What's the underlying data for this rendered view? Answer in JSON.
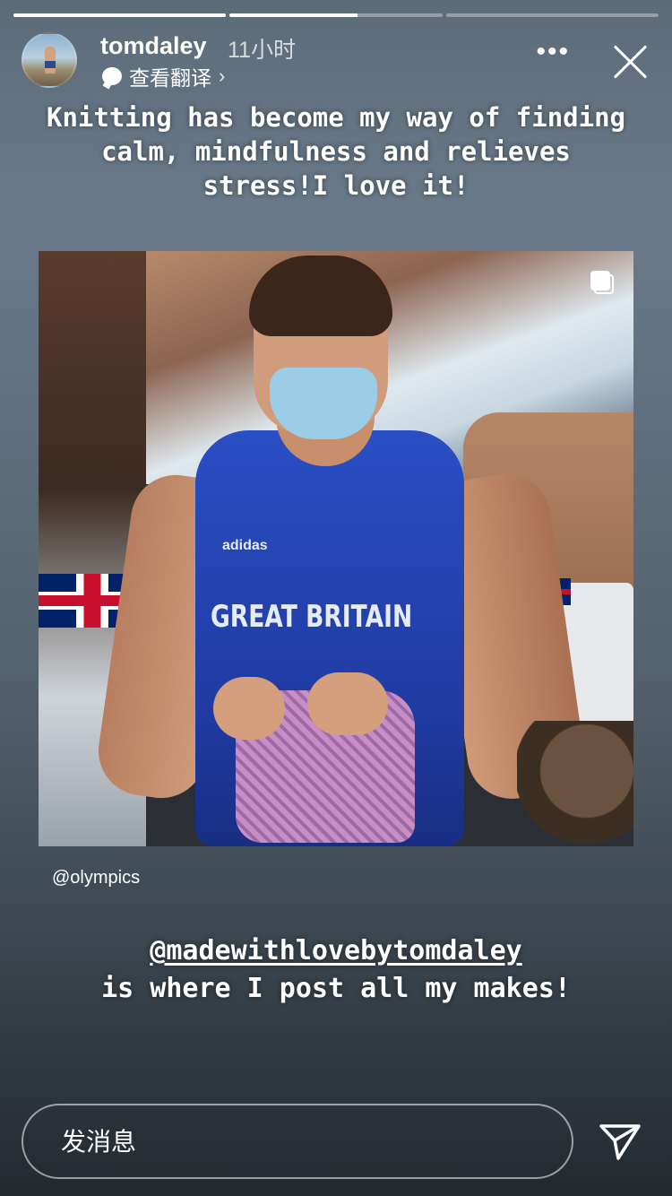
{
  "story": {
    "progress": [
      1.0,
      0.6,
      0.0
    ]
  },
  "header": {
    "username": "tomdaley",
    "time_ago": "11小时",
    "translate_label": "查看翻译",
    "more_label": "•••"
  },
  "caption_top": "Knitting has become my way of finding calm, mindfulness and relieves stress!I love it!",
  "photo": {
    "jersey_text": "GREAT BRITAIN",
    "brand_text": "adidas",
    "credit": "@olympics"
  },
  "caption_bottom": {
    "mention": "@madewithlovebytomdaley",
    "text": "is where I post all my makes!"
  },
  "reply": {
    "placeholder": "发消息"
  },
  "icons": {
    "send": "send-icon",
    "close": "close-icon",
    "more": "more-icon",
    "multi": "multiple-posts-icon"
  }
}
